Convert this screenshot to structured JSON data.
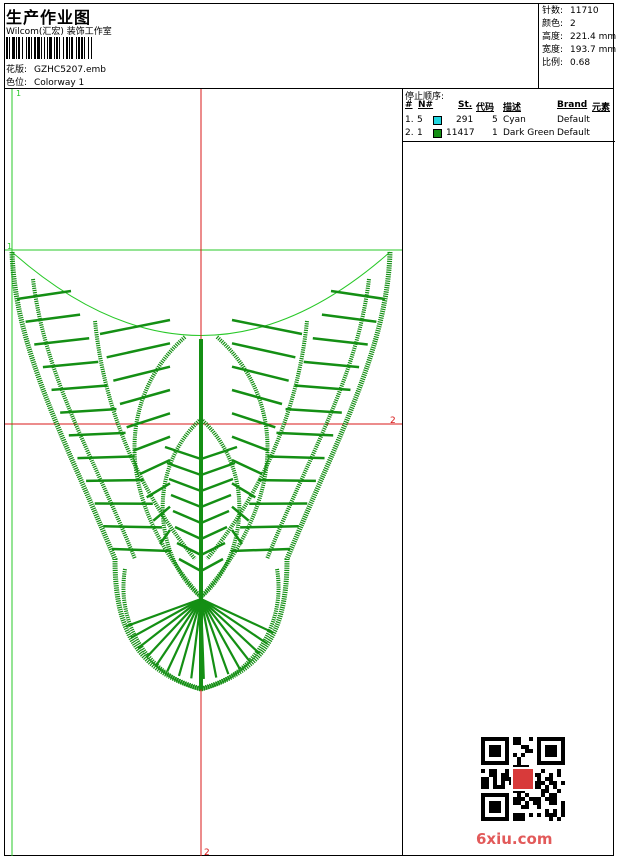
{
  "header": {
    "title": "生产作业图",
    "subtitle": "Wilcom(汇宏) 装饰工作室",
    "design_label": "花版:",
    "design_value": "GZHC5207.emb",
    "colorway_label": "色位:",
    "colorway_value": "Colorway 1"
  },
  "stats": [
    {
      "label": "针数:",
      "value": "11710"
    },
    {
      "label": "颜色:",
      "value": "2"
    },
    {
      "label": "高度:",
      "value": "221.4 mm"
    },
    {
      "label": "宽度:",
      "value": "193.7 mm"
    },
    {
      "label": "比例:",
      "value": "0.68"
    }
  ],
  "stop_sequence": {
    "title": "停止顺序:",
    "columns": [
      "#",
      "N#",
      "St.",
      "代码",
      "描述",
      "Brand",
      "元素"
    ],
    "rows": [
      {
        "index": "1.",
        "n": "5",
        "color": "#22d6e0",
        "stitches": "291",
        "code": "5",
        "description": "Cyan",
        "brand": "Default"
      },
      {
        "index": "2.",
        "n": "1",
        "color": "#148f14",
        "stitches": "11417",
        "code": "1",
        "description": "Dark Green",
        "brand": "Default"
      }
    ]
  },
  "canvas": {
    "marker_top": "1",
    "marker_left": "1",
    "marker_right": "2",
    "marker_bottom": "2",
    "axis_color": "#d81818",
    "guide_color": "#28c828",
    "stitch_color": "#148f14"
  },
  "watermark": "6xiu.com"
}
